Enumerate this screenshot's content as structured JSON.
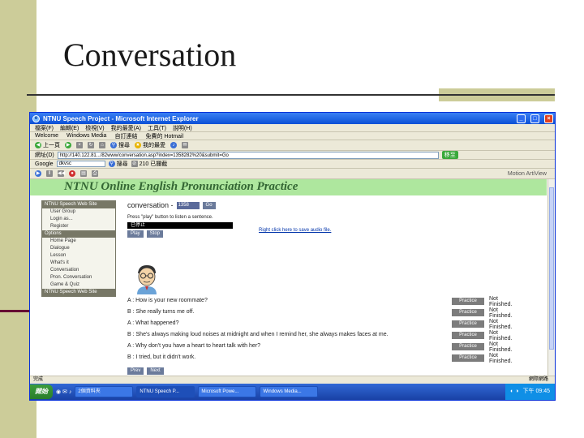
{
  "slide": {
    "title": "Conversation"
  },
  "window": {
    "title": "NTNU Speech Project - Microsoft Internet Explorer",
    "menu": [
      "檔案(F)",
      "編輯(E)",
      "檢視(V)",
      "我的最愛(A)",
      "工具(T)",
      "說明(H)"
    ],
    "links": [
      "Welcome",
      "Windows Media",
      "自訂連結",
      "免費的 Hotmail"
    ],
    "toolbar": {
      "back": "上一頁",
      "search": "搜尋",
      "favorites": "我的最愛"
    },
    "address_label": "網址(D)",
    "address_value": "http://140.122.81.../82www/conversation.asp?index=1358282%20&submit=Go",
    "go_label": "移至",
    "google_label": "Google",
    "google_query": "dkvsc",
    "google_search": "搜尋",
    "blocked_label": "已攔截",
    "blocked_count": "210",
    "media_label": "Motion ArtiView"
  },
  "site": {
    "title": "NTNU Online English Pronunciation Practice",
    "nav": [
      {
        "type": "head",
        "label": "NTNU Speech Web Site"
      },
      {
        "type": "item",
        "label": "User Group"
      },
      {
        "type": "item",
        "label": "Login as..."
      },
      {
        "type": "item",
        "label": "Register"
      },
      {
        "type": "head",
        "label": "Options"
      },
      {
        "type": "item",
        "label": "Home Page"
      },
      {
        "type": "item",
        "label": "Dialogue"
      },
      {
        "type": "item",
        "label": "Lesson"
      },
      {
        "type": "item",
        "label": "What's it"
      },
      {
        "type": "item",
        "label": "Conversation"
      },
      {
        "type": "item",
        "label": "Pron. Conversation"
      },
      {
        "type": "item",
        "label": "Game & Quiz"
      },
      {
        "type": "head",
        "label": "NTNU Speech Web Site"
      }
    ],
    "conversation_label": "conversation -",
    "conversation_select": "1358",
    "go_button": "Go",
    "instruction": "Press \"play\" button to listen a sentence.",
    "player_label": "已停止",
    "play_button": "Play",
    "stop_button": "Stop",
    "save_link": "Right click here to save audio file.",
    "lines": [
      {
        "speaker": "A",
        "text": "How is your new roommate?",
        "practice": "Practice",
        "status": "Not Finished."
      },
      {
        "speaker": "B",
        "text": "She really turns me off.",
        "practice": "Practice",
        "status": "Not Finished."
      },
      {
        "speaker": "A",
        "text": "What happened?",
        "practice": "Practice",
        "status": "Not Finished."
      },
      {
        "speaker": "B",
        "text": "She's always making loud noises at midnight and when I remind her, she always makes faces at me.",
        "practice": "Practice",
        "status": "Not Finished."
      },
      {
        "speaker": "A",
        "text": "Why don't you have a heart to heart talk with her?",
        "practice": "Practice",
        "status": "Not Finished."
      },
      {
        "speaker": "B",
        "text": "I tried, but it didn't work.",
        "practice": "Practice",
        "status": "Not Finished."
      }
    ],
    "prev_button": "Prev",
    "next_button": "Next"
  },
  "status_bar": {
    "left": "完成",
    "right": "網際網路"
  },
  "taskbar": {
    "start": "開始",
    "items": [
      "2個資料夾",
      "NTNU Speech P...",
      "Microsoft Powe...",
      "Windows Media..."
    ],
    "clock": "下午 09:45"
  },
  "colors": {
    "slide_accent": "#cccc99",
    "banner": "#aee79e",
    "title_blue": "#0a4fd6"
  }
}
